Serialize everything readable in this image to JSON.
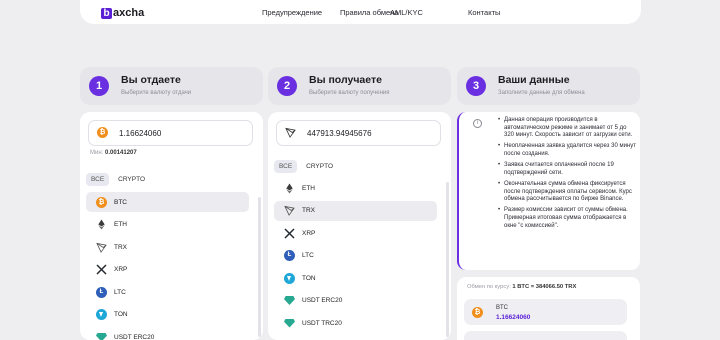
{
  "brand": {
    "logo_mark": "b",
    "name": "axcha"
  },
  "nav": [
    "Предупреждение",
    "Правила обмена",
    "AML/KYC",
    "Контакты"
  ],
  "give": {
    "step": "1",
    "title": "Вы отдаете",
    "subtitle": "Выберите валюту отдачи",
    "amount": "1.16624060",
    "min_label": "Мин:",
    "min_value": "0.00141207",
    "filters": [
      "ВСЕ",
      "CRYPTO"
    ],
    "items": [
      "BTC",
      "ETH",
      "TRX",
      "XRP",
      "LTC",
      "TON",
      "USDT ERC20"
    ],
    "selected": "BTC"
  },
  "get": {
    "step": "2",
    "title": "Вы получаете",
    "subtitle": "Выберите валюту получения",
    "amount": "447913.94945676",
    "filters": [
      "ВСЕ",
      "CRYPTO"
    ],
    "items": [
      "ETH",
      "TRX",
      "XRP",
      "LTC",
      "TON",
      "USDT ERC20",
      "USDT TRC20"
    ],
    "selected": "TRX"
  },
  "details": {
    "step": "3",
    "title": "Ваши данные",
    "subtitle": "Заполните данные для обмена",
    "info_icon_glyph": "i",
    "bullets": [
      "Данная операция производится в автоматическом режиме и занимает от 5 до 320 минут. Скорость зависит от загрузки сети.",
      "Неоплаченная заявка удалится через 30 минут после создания.",
      "Заявка считается оплаченной после 19 подтверждений сети.",
      "Окончательная сумма обмена фиксируется после подтверждения оплаты сервисом. Курс обмена рассчитывается по бирже Binance.",
      "Размер комиссии зависит от суммы обмена. Примерная итоговая сумма отображается в окне \"с комиссией\"."
    ],
    "rate_label": "Обмен по курсу:",
    "rate_value": "1 BTC = 384066.50 TRX",
    "send_coin": "BTC",
    "send_amount": "1.16624060"
  },
  "colors": {
    "accent": "#6a2fe0",
    "btc": "#f08f1c",
    "ltc": "#2f5fb8",
    "ton": "#1fa7d8",
    "usdt": "#27a890"
  },
  "icons": {
    "BTC": "btc-icon",
    "ETH": "eth-icon",
    "TRX": "trx-icon",
    "XRP": "xrp-icon",
    "LTC": "ltc-icon",
    "TON": "ton-icon",
    "USDT ERC20": "usdt-icon",
    "USDT TRC20": "usdt-icon"
  }
}
